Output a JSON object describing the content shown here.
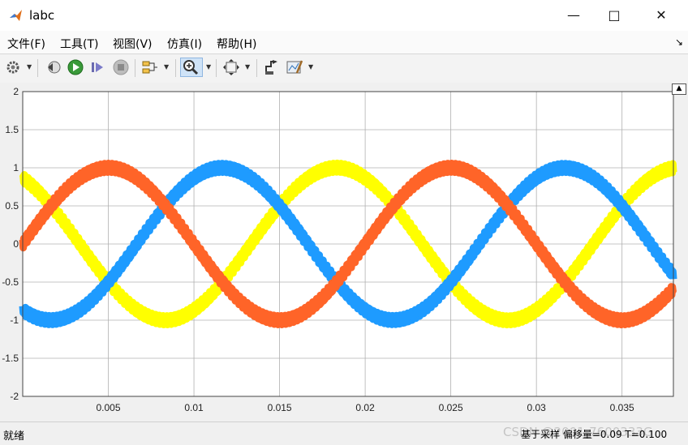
{
  "window": {
    "title": "labc",
    "minimize_icon": "minimize-icon",
    "maximize_icon": "maximize-icon",
    "close_icon": "close-icon"
  },
  "menu": {
    "items": [
      "文件(F)",
      "工具(T)",
      "视图(V)",
      "仿真(I)",
      "帮助(H)"
    ]
  },
  "toolbar": {
    "icons": [
      "gear-icon",
      "step-back-icon",
      "run-icon",
      "step-forward-icon",
      "stop-icon",
      "signal-select-icon",
      "zoom-in-icon",
      "fit-view-icon",
      "cursor-measure-icon",
      "style-edit-icon"
    ]
  },
  "colors": {
    "phase_a": "#ffff00",
    "phase_b": "#1e9bff",
    "phase_c": "#ff6428",
    "plot_bg": "#ffffff",
    "grid": "#b0b0b0"
  },
  "chart_data": {
    "type": "line",
    "xlim": [
      0,
      0.038
    ],
    "ylim": [
      -2,
      2
    ],
    "grid": true,
    "x_ticks": [
      "0.005",
      "0.01",
      "0.015",
      "0.02",
      "0.025",
      "0.03",
      "0.035"
    ],
    "y_ticks": [
      "2",
      "1.5",
      "1",
      "0.5",
      "0",
      "-0.5",
      "-1",
      "-1.5",
      "-2"
    ],
    "frequency_hz": 50,
    "amplitude": 1.0,
    "series": [
      {
        "color": "#ffff00",
        "phase_deg": 120
      },
      {
        "color": "#1e9bff",
        "phase_deg": -120
      },
      {
        "color": "#ff6428",
        "phase_deg": 0
      }
    ]
  },
  "status": {
    "left": "就绪",
    "right": "基于采样   偏移量=0.09   T=0.100"
  },
  "watermark": "CSDN @2001-7600333G"
}
